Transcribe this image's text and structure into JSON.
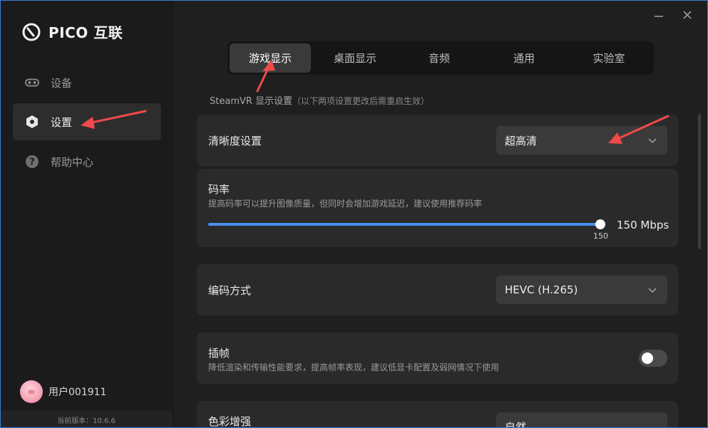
{
  "app": {
    "logo_text": "PICO 互联"
  },
  "sidebar": {
    "items": [
      {
        "label": "设备",
        "icon": "vr-goggles-icon"
      },
      {
        "label": "设置",
        "icon": "settings-hex-icon",
        "active": true
      },
      {
        "label": "帮助中心",
        "icon": "help-circle-icon"
      }
    ],
    "user": {
      "name": "用户001911"
    },
    "version": "当前版本：10.6.6"
  },
  "window": {
    "minimize_icon": "minimize-icon",
    "close_icon": "close-icon"
  },
  "tabs": [
    {
      "label": "游戏显示",
      "active": true
    },
    {
      "label": "桌面显示"
    },
    {
      "label": "音频"
    },
    {
      "label": "通用"
    },
    {
      "label": "实验室"
    }
  ],
  "section": {
    "title": "SteamVR 显示设置",
    "note": "（以下两项设置更改后需重启生效）"
  },
  "settings": {
    "clarity": {
      "title": "清晰度设置",
      "value": "超高清"
    },
    "bitrate": {
      "title": "码率",
      "desc": "提高码率可以提升图像质量，但同时会增加游戏延迟，建议使用推荐码率",
      "tick": "150",
      "value_text": "150 Mbps",
      "fill_fraction": 1.0
    },
    "encoding": {
      "title": "编码方式",
      "value": "HEVC (H.265)"
    },
    "frame_interp": {
      "title": "插帧",
      "desc": "降低渲染和传输性能要求，提高帧率表现，建议低显卡配置及弱网情况下使用",
      "enabled": false
    },
    "color": {
      "title": "色彩增强",
      "value": "自然"
    }
  },
  "colors": {
    "accent": "#4a8ff0",
    "annotation": "#f04a4a"
  }
}
